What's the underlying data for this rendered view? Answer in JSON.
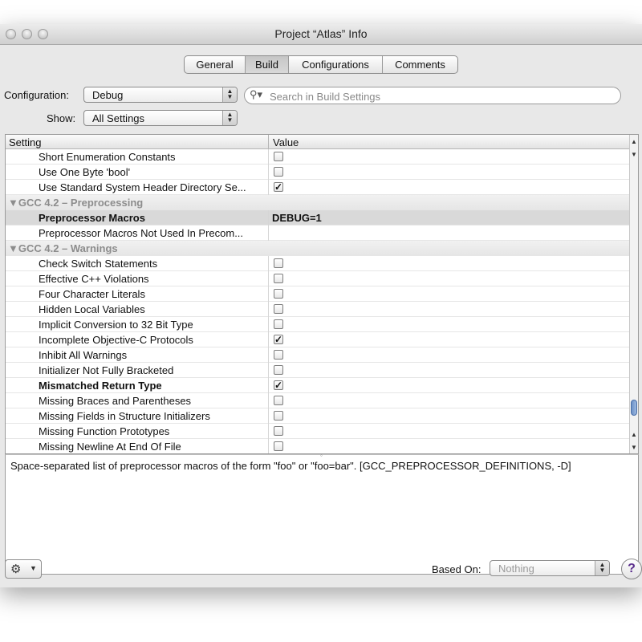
{
  "window": {
    "title": "Project “Atlas” Info"
  },
  "tabs": [
    {
      "label": "General",
      "active": false
    },
    {
      "label": "Build",
      "active": true
    },
    {
      "label": "Configurations",
      "active": false
    },
    {
      "label": "Comments",
      "active": false
    }
  ],
  "configuration": {
    "label": "Configuration:",
    "value": "Debug"
  },
  "show": {
    "label": "Show:",
    "value": "All Settings"
  },
  "search": {
    "placeholder": "Search in Build Settings",
    "value": ""
  },
  "table": {
    "columns": [
      "Setting",
      "Value"
    ],
    "rows": [
      {
        "type": "setting",
        "name": "Short Enumeration Constants",
        "checkbox": true,
        "checked": false
      },
      {
        "type": "setting",
        "name": "Use One Byte 'bool'",
        "checkbox": true,
        "checked": false
      },
      {
        "type": "setting",
        "name": "Use Standard System Header Directory Se...",
        "checkbox": true,
        "checked": true
      },
      {
        "type": "group",
        "name": "▼GCC 4.2 – Preprocessing"
      },
      {
        "type": "setting",
        "name": "Preprocessor Macros",
        "value": "DEBUG=1",
        "bold": true,
        "selected": true
      },
      {
        "type": "setting",
        "name": "Preprocessor Macros Not Used In Precom...",
        "value": ""
      },
      {
        "type": "group",
        "name": "▼GCC 4.2 – Warnings"
      },
      {
        "type": "setting",
        "name": "Check Switch Statements",
        "checkbox": true,
        "checked": false
      },
      {
        "type": "setting",
        "name": "Effective C++ Violations",
        "checkbox": true,
        "checked": false
      },
      {
        "type": "setting",
        "name": "Four Character Literals",
        "checkbox": true,
        "checked": false
      },
      {
        "type": "setting",
        "name": "Hidden Local Variables",
        "checkbox": true,
        "checked": false
      },
      {
        "type": "setting",
        "name": "Implicit Conversion to 32 Bit Type",
        "checkbox": true,
        "checked": false
      },
      {
        "type": "setting",
        "name": "Incomplete Objective-C Protocols",
        "checkbox": true,
        "checked": true
      },
      {
        "type": "setting",
        "name": "Inhibit All Warnings",
        "checkbox": true,
        "checked": false
      },
      {
        "type": "setting",
        "name": "Initializer Not Fully Bracketed",
        "checkbox": true,
        "checked": false
      },
      {
        "type": "setting",
        "name": "Mismatched Return Type",
        "checkbox": true,
        "checked": true,
        "bold": true
      },
      {
        "type": "setting",
        "name": "Missing Braces and Parentheses",
        "checkbox": true,
        "checked": false
      },
      {
        "type": "setting",
        "name": "Missing Fields in Structure Initializers",
        "checkbox": true,
        "checked": false
      },
      {
        "type": "setting",
        "name": "Missing Function Prototypes",
        "checkbox": true,
        "checked": false
      },
      {
        "type": "setting",
        "name": "Missing Newline At End Of File",
        "checkbox": true,
        "checked": false
      }
    ]
  },
  "description": "Space-separated list of preprocessor macros of the form \"foo\" or \"foo=bar\". [GCC_PREPROCESSOR_DEFINITIONS, -D]",
  "footer": {
    "based_on_label": "Based On:",
    "based_on_value": "Nothing",
    "help_symbol": "?",
    "action_menu_icon": "gear-icon"
  }
}
